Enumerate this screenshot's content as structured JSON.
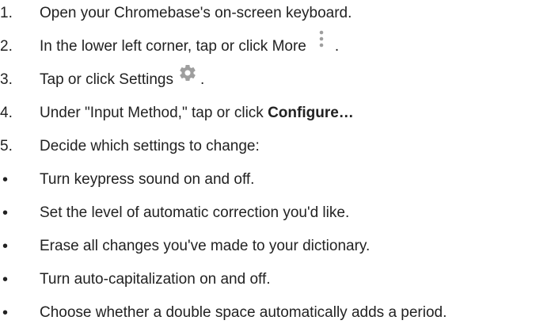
{
  "steps": [
    {
      "num": "1.",
      "text": "Open your Chromebase's on-screen keyboard."
    },
    {
      "num": "2.",
      "text_before": "In the lower left corner, tap or click More",
      "icon": "more-vert-icon",
      "text_after": "."
    },
    {
      "num": "3.",
      "text_before": "Tap or click Settings",
      "icon": "gear-icon",
      "text_after": "."
    },
    {
      "num": "4.",
      "text_before": "Under \"Input Method,\" tap or click ",
      "bold": "Configure…"
    },
    {
      "num": "5.",
      "text": "Decide which settings to change:"
    }
  ],
  "bullets": [
    {
      "marker": "•",
      "text": "Turn keypress sound on and off."
    },
    {
      "marker": "•",
      "text": "Set the level of automatic correction you'd like."
    },
    {
      "marker": "•",
      "text": "Erase all changes you've made to your dictionary."
    },
    {
      "marker": "•",
      "text": "Turn auto-capitalization on and off."
    },
    {
      "marker": "•",
      "text": "Choose whether a double space automatically adds a period."
    }
  ],
  "colors": {
    "text": "#222222",
    "icon": "#9e9e9e"
  }
}
